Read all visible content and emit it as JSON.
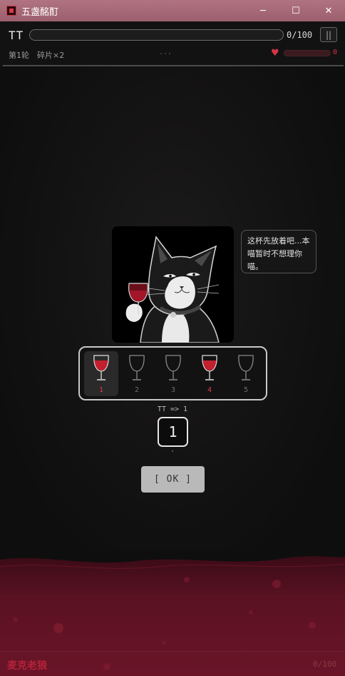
{
  "window": {
    "title": "五盏酩酊",
    "app_icon": "app-logo-icon",
    "controls": {
      "minimize": "─",
      "maximize": "☐",
      "close": "✕"
    }
  },
  "hud": {
    "player_name": "TT",
    "progress": {
      "text": "0/100",
      "value": 0,
      "max": 100
    },
    "pause_label": "||",
    "round_label": "第1轮",
    "shards_label": "碎片×2",
    "dots": "...",
    "heart_icon": "heart-icon",
    "hp_value": "0",
    "hp_fraction": 0
  },
  "speech": {
    "text": "这杯先放着吧...本喵暂时不想理你喵。"
  },
  "glasses": [
    {
      "number": "1",
      "filled": true,
      "selected": true
    },
    {
      "number": "2",
      "filled": false,
      "selected": false
    },
    {
      "number": "3",
      "filled": false,
      "selected": false
    },
    {
      "number": "4",
      "filled": true,
      "selected": false
    },
    {
      "number": "5",
      "filled": false,
      "selected": false
    }
  ],
  "choice": {
    "line": "TT => 1",
    "value": "1"
  },
  "ok_button": "[ OK ]",
  "opponent": {
    "name": "麦克老狼",
    "progress_text": "0/100"
  },
  "colors": {
    "wine_red": "#c2202f",
    "accent_red": "#e0394c",
    "titlebar": "#a86b78"
  }
}
